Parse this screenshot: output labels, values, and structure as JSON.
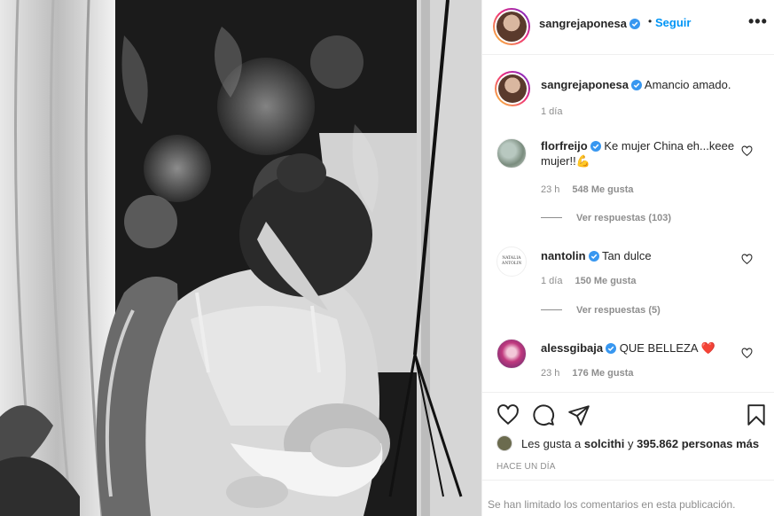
{
  "post": {
    "username": "sangrejaponesa",
    "follow_label": "Seguir",
    "separator": "•",
    "more_label": "•••",
    "caption": {
      "username": "sangrejaponesa",
      "text": "Amancio amado.",
      "time": "1 día"
    }
  },
  "comments": [
    {
      "username": "florfreijo",
      "text": "Ke mujer China eh...keee mujer!!💪",
      "time": "23 h",
      "likes": "548 Me gusta",
      "replies": "Ver respuestas (103)"
    },
    {
      "username": "nantolin",
      "text": "Tan dulce",
      "time": "1 día",
      "likes": "150 Me gusta",
      "replies": "Ver respuestas (5)",
      "avatar_text": "NATALIA ANTOLIN"
    },
    {
      "username": "alessgibaja",
      "text": "QUE BELLEZA ❤️",
      "time": "23 h",
      "likes": "176 Me gusta"
    }
  ],
  "footer": {
    "likes_prefix": "Les gusta a",
    "likes_user": "solcithi",
    "likes_middle": "y",
    "likes_count": "395.862 personas más",
    "posted_ago": "HACE UN DÍA",
    "comments_limited": "Se han limitado los comentarios en esta publicación."
  },
  "icons": [
    "verified-icon",
    "heart-icon",
    "comment-icon",
    "share-icon",
    "bookmark-icon",
    "more-icon"
  ],
  "colors": {
    "accent": "#0095f6",
    "verified": "#3897f0",
    "text": "#262626",
    "muted": "#8e8e8e",
    "border": "#efefef"
  }
}
